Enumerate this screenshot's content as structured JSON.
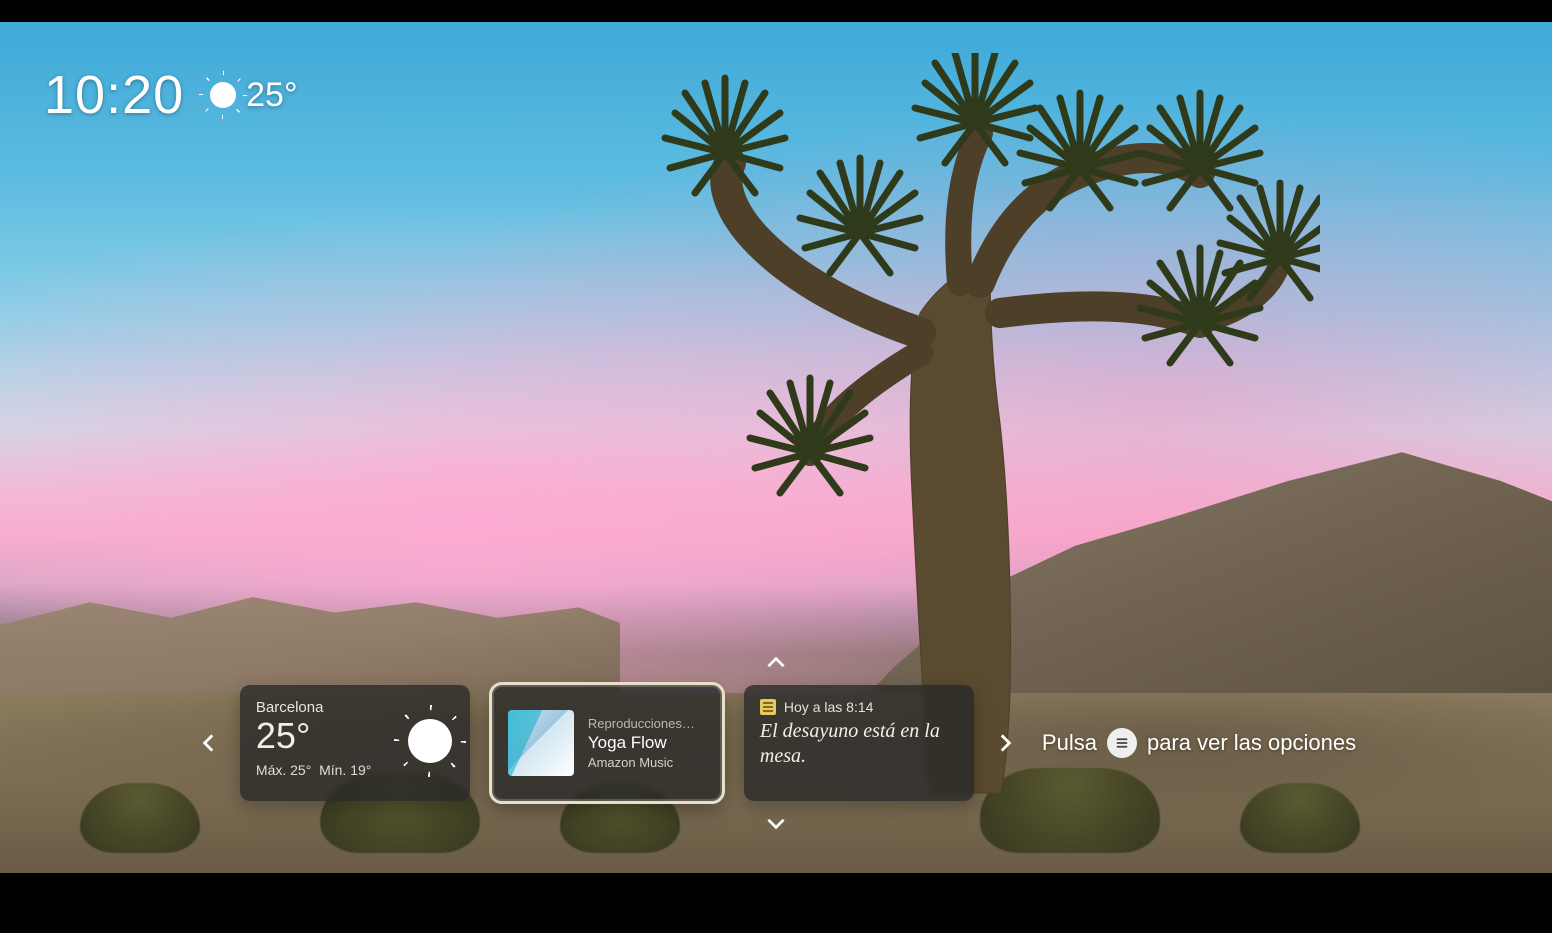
{
  "status": {
    "time": "10:20",
    "temp": "25°"
  },
  "carousel": {
    "cards": [
      {
        "type": "weather",
        "city": "Barcelona",
        "temp": "25°",
        "high_label": "Máx. 25°",
        "low_label": "Mín. 19°"
      },
      {
        "type": "music",
        "subhead": "Reproducciones…",
        "title": "Yoga Flow",
        "source": "Amazon Music"
      },
      {
        "type": "note",
        "time_label": "Hoy a las 8:14",
        "body": "El desayuno está en la mesa."
      }
    ]
  },
  "hint": {
    "prefix": "Pulsa",
    "suffix": "para ver las opciones"
  }
}
